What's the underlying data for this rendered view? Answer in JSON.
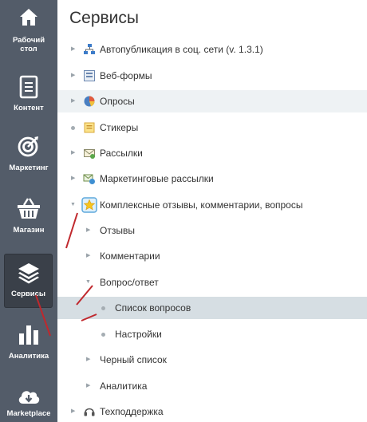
{
  "sidebar": {
    "items": [
      {
        "label1": "Рабочий",
        "label2": "стол",
        "icon": "home-icon"
      },
      {
        "label1": "Контент",
        "icon": "document-icon"
      },
      {
        "label1": "Маркетинг",
        "icon": "target-icon"
      },
      {
        "label1": "Магазин",
        "icon": "basket-icon"
      },
      {
        "label1": "Сервисы",
        "icon": "layers-icon"
      },
      {
        "label1": "Аналитика",
        "icon": "bar-chart-icon"
      },
      {
        "label1": "Marketplace",
        "icon": "cloud-download-icon"
      }
    ]
  },
  "page": {
    "title": "Сервисы"
  },
  "tree": {
    "autopost": "Автопубликация в соц. сети (v. 1.3.1)",
    "webforms": "Веб-формы",
    "polls": "Опросы",
    "stickers": "Стикеры",
    "mailings": "Рассылки",
    "marketing_mailings": "Маркетинговые рассылки",
    "complex_reviews": "Комплексные отзывы, комментарии, вопросы",
    "reviews": "Отзывы",
    "comments": "Комментарии",
    "qa": "Вопрос/ответ",
    "question_list": "Список вопросов",
    "settings": "Настройки",
    "blacklist": "Черный список",
    "analytics": "Аналитика",
    "support": "Техподдержка"
  },
  "colors": {
    "sidebar_bg": "#535c69",
    "selected_row": "#d6dee3",
    "annotation": "#c0282d"
  }
}
